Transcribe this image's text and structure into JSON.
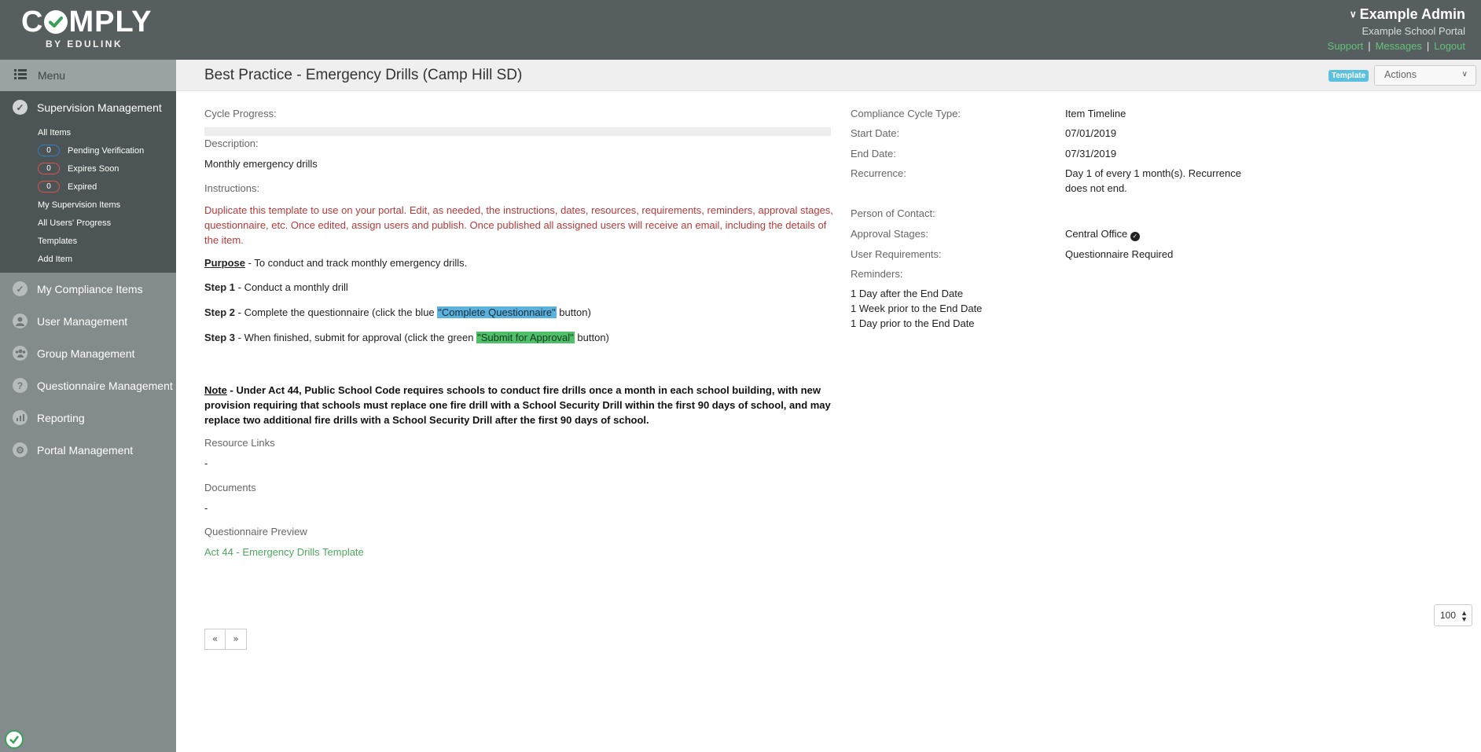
{
  "header": {
    "logo_text_left": "C",
    "logo_text_right": "MPLY",
    "logo_sub": "BY EDULINK",
    "user_name": "Example Admin",
    "portal_name": "Example School Portal",
    "links": [
      "Support",
      "Messages",
      "Logout"
    ],
    "link_color": "#62c27a"
  },
  "sidebar": {
    "menu_label": "Menu",
    "section_active": "Supervision Management",
    "sub_items": [
      {
        "label": "All Items"
      },
      {
        "label": "Pending Verification",
        "count": "0",
        "badge": "blue"
      },
      {
        "label": "Expires Soon",
        "count": "0",
        "badge": "red"
      },
      {
        "label": "Expired",
        "count": "0",
        "badge": "red"
      },
      {
        "label": "My Supervision Items"
      },
      {
        "label": "All Users' Progress"
      },
      {
        "label": "Templates"
      },
      {
        "label": "Add Item"
      }
    ],
    "nav": [
      {
        "label": "My Compliance Items",
        "icon": "check-circle-icon"
      },
      {
        "label": "User Management",
        "icon": "user-icon"
      },
      {
        "label": "Group Management",
        "icon": "group-icon"
      },
      {
        "label": "Questionnaire Management",
        "icon": "question-icon"
      },
      {
        "label": "Reporting",
        "icon": "bar-chart-icon"
      },
      {
        "label": "Portal Management",
        "icon": "gear-icon"
      }
    ]
  },
  "main": {
    "title": "Best Practice - Emergency Drills (Camp Hill SD)",
    "template_badge": "Template",
    "actions_label": "Actions",
    "cycle_progress_label": "Cycle Progress:",
    "description_label": "Description:",
    "description": "Monthly emergency drills",
    "instructions_label": "Instructions:",
    "instructions": "Duplicate this template to use on your portal.  Edit, as needed, the instructions, dates, resources, requirements, reminders, approval stages, questionnaire, etc.  Once edited, assign users and publish. Once published all assigned users will receive an email, including the details of the item.",
    "purpose_label": "Purpose",
    "purpose_text": " - To conduct and track monthly emergency drills.",
    "step1_label": "Step 1",
    "step1_text": " - Conduct a monthly drill",
    "step2_label": "Step 2",
    "step2_text": " - Complete the questionnaire (click the blue ",
    "step2_highlight": "\"Complete Questionnaire\"",
    "step2_end": " button)",
    "step3_label": "Step 3",
    "step3_text": " - When finished, submit for approval (click the green ",
    "step3_highlight": "\"Submit for Approval\"",
    "step3_end": " button)",
    "note_label": "Note",
    "note_text": " - Under Act 44, Public School Code requires schools to conduct fire drills once a month in each school building, with new provision requiring that schools must replace one fire drill with a School Security Drill within the first 90 days of school, and may replace two additional fire drills with a School Security Drill after the first 90 days of school.",
    "resource_links_label": "Resource Links",
    "resource_links_value": "-",
    "documents_label": "Documents",
    "documents_value": "-",
    "questionnaire_preview_label": "Questionnaire Preview",
    "questionnaire_link": "Act 44 - Emergency Drills Template"
  },
  "details": {
    "cycle_type_label": "Compliance Cycle Type:",
    "cycle_type": "Item Timeline",
    "start_label": "Start Date:",
    "start": "07/01/2019",
    "end_label": "End Date:",
    "end": "07/31/2019",
    "recurrence_label": "Recurrence:",
    "recurrence_line1": "Day 1 of every 1 month(s). Recurrence",
    "recurrence_line2": "does not end.",
    "contact_label": "Person of Contact:",
    "approval_label": "Approval Stages:",
    "approval": "Central Office",
    "user_req_label": "User Requirements:",
    "user_req": "Questionnaire Required",
    "reminders_label": "Reminders:",
    "reminders": [
      "1 Day after the End Date",
      "1 Week prior to the End Date",
      "1 Day prior to the End Date"
    ]
  },
  "pagination": {
    "prev": "«",
    "next": "»",
    "per_page": "100"
  }
}
